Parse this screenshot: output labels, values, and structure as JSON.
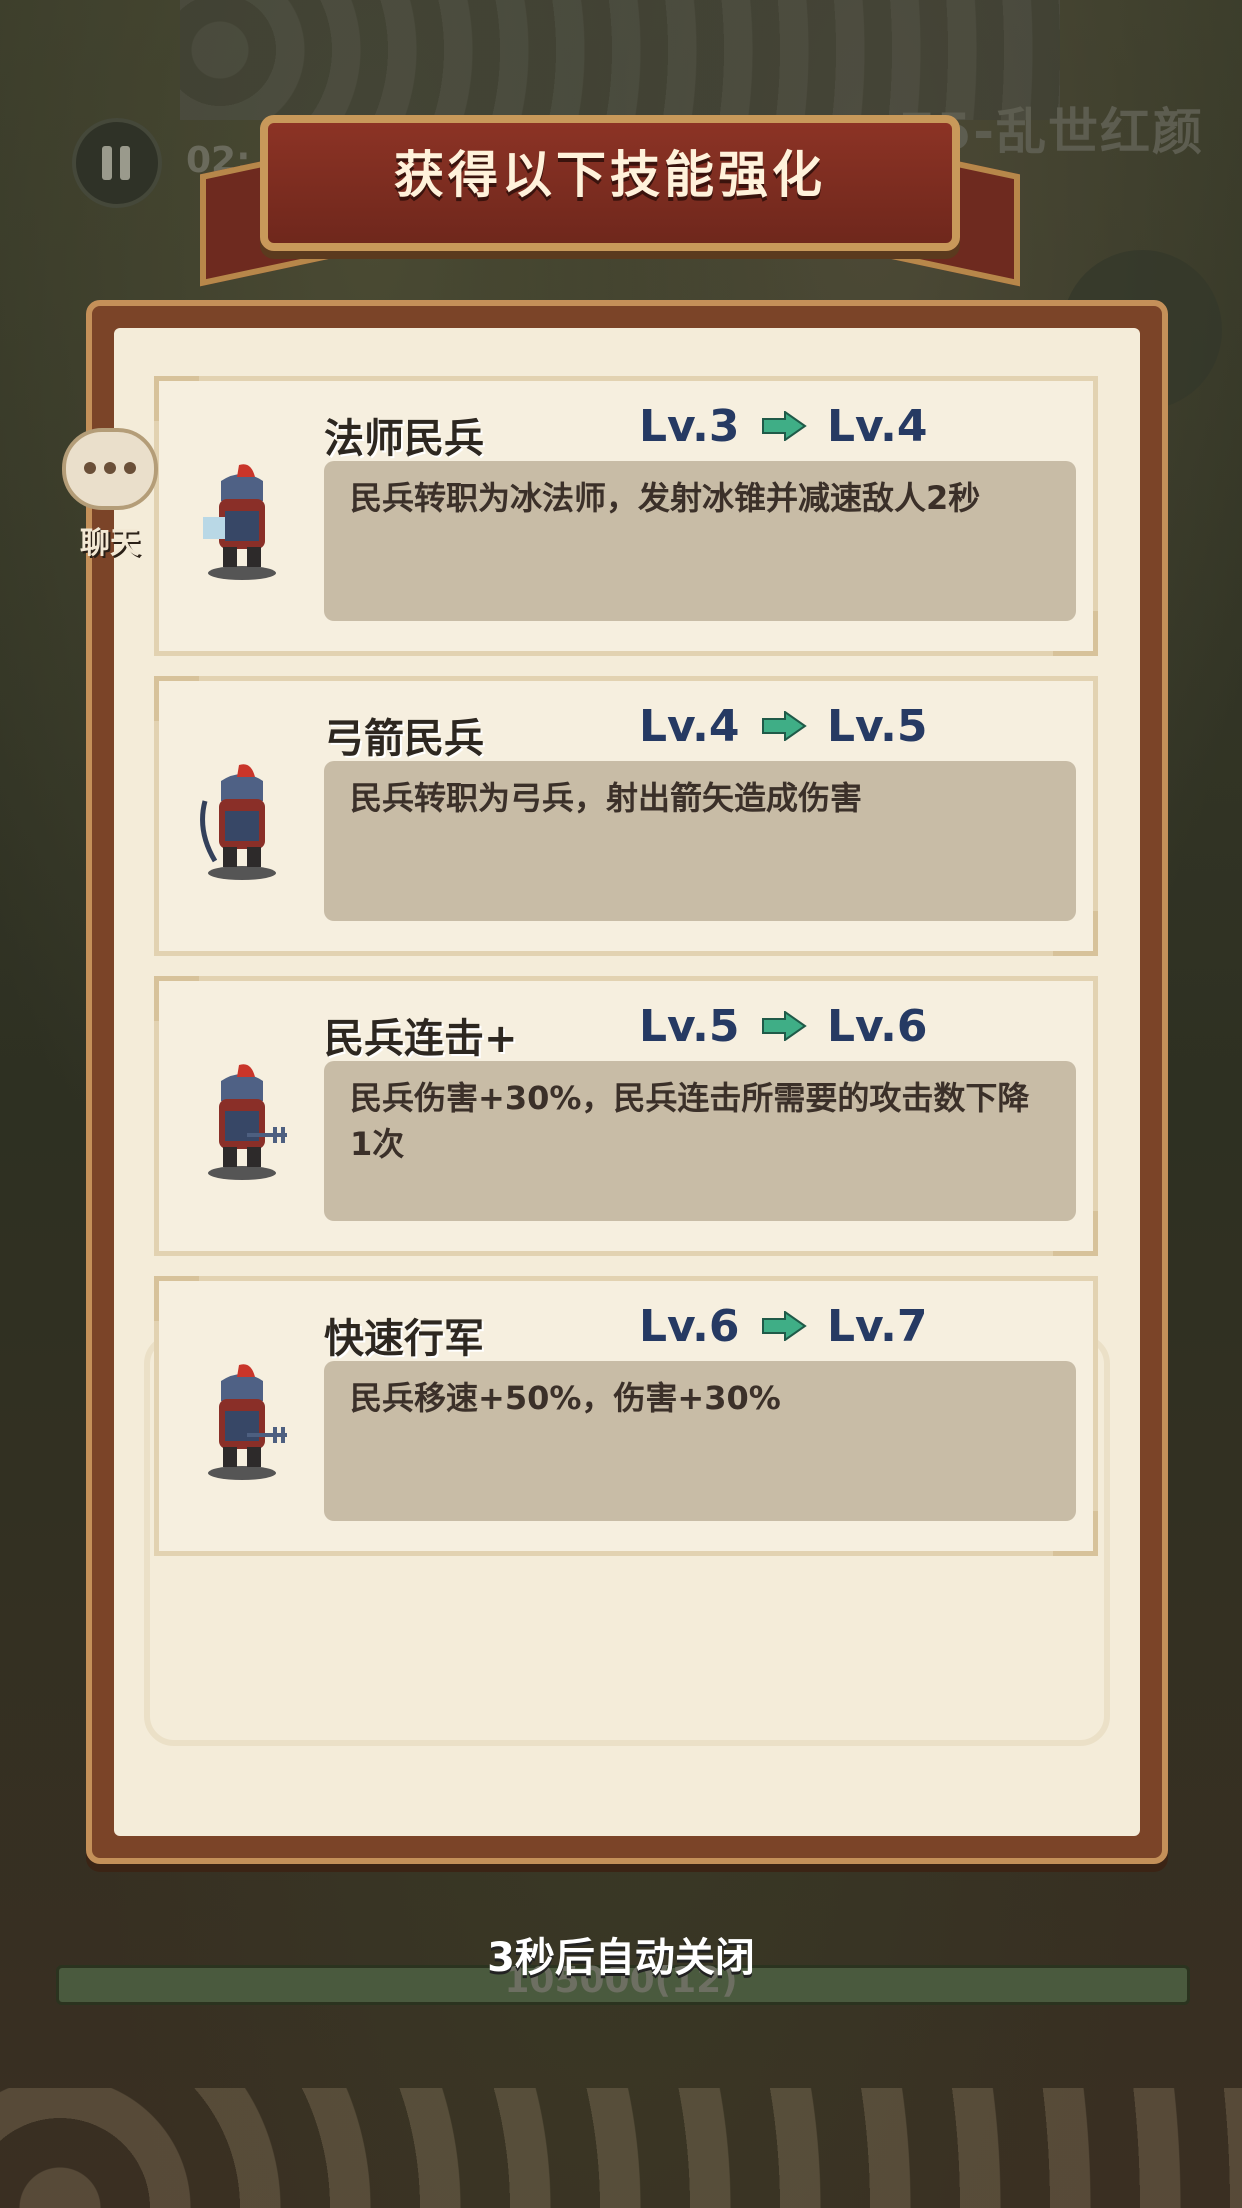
{
  "hud": {
    "timer": "02:",
    "level_name": "75-乱世红颜",
    "hp_text": "105000(12)"
  },
  "banner": {
    "title": "获得以下技能强化"
  },
  "chat": {
    "label": "聊天"
  },
  "skills": [
    {
      "name": "法师民兵",
      "from": "Lv.3",
      "to": "Lv.4",
      "desc": "民兵转职为冰法师，发射冰锥并减速敌人2秒"
    },
    {
      "name": "弓箭民兵",
      "from": "Lv.4",
      "to": "Lv.5",
      "desc": "民兵转职为弓兵，射出箭矢造成伤害"
    },
    {
      "name": "民兵连击+",
      "from": "Lv.5",
      "to": "Lv.6",
      "desc": "民兵伤害+30%，民兵连击所需要的攻击数下降1次"
    },
    {
      "name": "快速行军",
      "from": "Lv.6",
      "to": "Lv.7",
      "desc": "民兵移速+50%，伤害+30%"
    }
  ],
  "footer": {
    "autoclose": "3秒后自动关闭"
  },
  "colors": {
    "banner": "#7f2d22",
    "level_text": "#263a63",
    "arrow": "#3fae86",
    "desc_bg": "#c8bca6"
  }
}
